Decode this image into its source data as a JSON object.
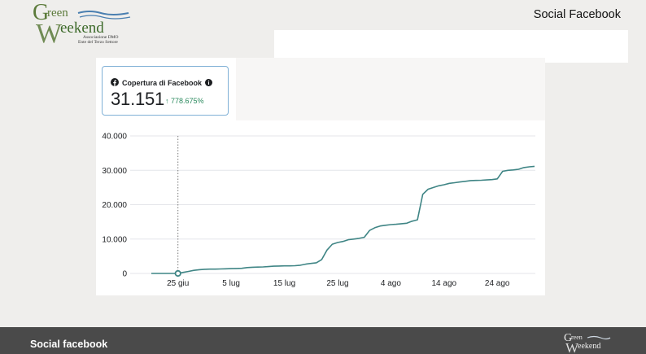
{
  "header": {
    "page_title": "Social Facebook",
    "logo": {
      "name": "Green Weekend",
      "line1": "Associazione DMO",
      "line2": "Ente del Terzo Settore"
    }
  },
  "kpi": {
    "icon": "facebook-icon",
    "title": "Copertura di Facebook",
    "info_icon": "info-icon",
    "value": "31.151",
    "delta": "↑ 778.675%"
  },
  "chart_data": {
    "type": "line",
    "title": "",
    "xlabel": "",
    "ylabel": "",
    "x_tick_labels": [
      "25 giu",
      "5 lug",
      "15 lug",
      "25 lug",
      "4 ago",
      "14 ago",
      "24 ago"
    ],
    "y_tick_labels": [
      "0",
      "10.000",
      "20.000",
      "30.000",
      "40.000"
    ],
    "ylim": [
      0,
      40000
    ],
    "grid": true,
    "line_color": "#3f8585",
    "marker_date": "25 giu",
    "series": [
      {
        "x": [
          "20 giu",
          "21 giu",
          "22 giu",
          "23 giu",
          "24 giu",
          "25 giu",
          "26 giu",
          "27 giu",
          "28 giu",
          "29 giu",
          "30 giu",
          "1 lug",
          "2 lug",
          "3 lug",
          "4 lug",
          "5 lug",
          "6 lug",
          "7 lug",
          "8 lug",
          "9 lug",
          "10 lug",
          "11 lug",
          "12 lug",
          "13 lug",
          "14 lug",
          "15 lug",
          "16 lug",
          "17 lug",
          "18 lug",
          "19 lug",
          "20 lug",
          "21 lug",
          "22 lug",
          "23 lug",
          "24 lug",
          "25 lug",
          "26 lug",
          "27 lug",
          "28 lug",
          "29 lug",
          "30 lug",
          "31 lug",
          "1 ago",
          "2 ago",
          "3 ago",
          "4 ago",
          "5 ago",
          "6 ago",
          "7 ago",
          "8 ago",
          "9 ago",
          "10 ago",
          "11 ago",
          "12 ago",
          "13 ago",
          "14 ago",
          "15 ago",
          "16 ago",
          "17 ago",
          "18 ago",
          "19 ago",
          "20 ago",
          "21 ago",
          "22 ago",
          "23 ago",
          "24 ago",
          "25 ago",
          "26 ago",
          "27 ago",
          "28 ago",
          "29 ago",
          "30 ago",
          "31 ago"
        ],
        "values": [
          0,
          0,
          0,
          0,
          0,
          0,
          300,
          600,
          900,
          1100,
          1200,
          1250,
          1250,
          1300,
          1350,
          1400,
          1450,
          1500,
          1700,
          1800,
          1850,
          1900,
          2000,
          2100,
          2150,
          2200,
          2200,
          2250,
          2400,
          2700,
          2900,
          3100,
          4000,
          6800,
          8500,
          9000,
          9300,
          9800,
          10000,
          10200,
          10500,
          12500,
          13300,
          13800,
          14000,
          14200,
          14300,
          14450,
          14600,
          15200,
          15600,
          23000,
          24500,
          25000,
          25500,
          25800,
          26200,
          26400,
          26600,
          26800,
          27000,
          27050,
          27100,
          27200,
          27300,
          27500,
          29700,
          30000,
          30100,
          30300,
          30800,
          31000,
          31151
        ]
      }
    ]
  },
  "footer": {
    "title": "Social facebook",
    "logo": "Green Weekend"
  }
}
